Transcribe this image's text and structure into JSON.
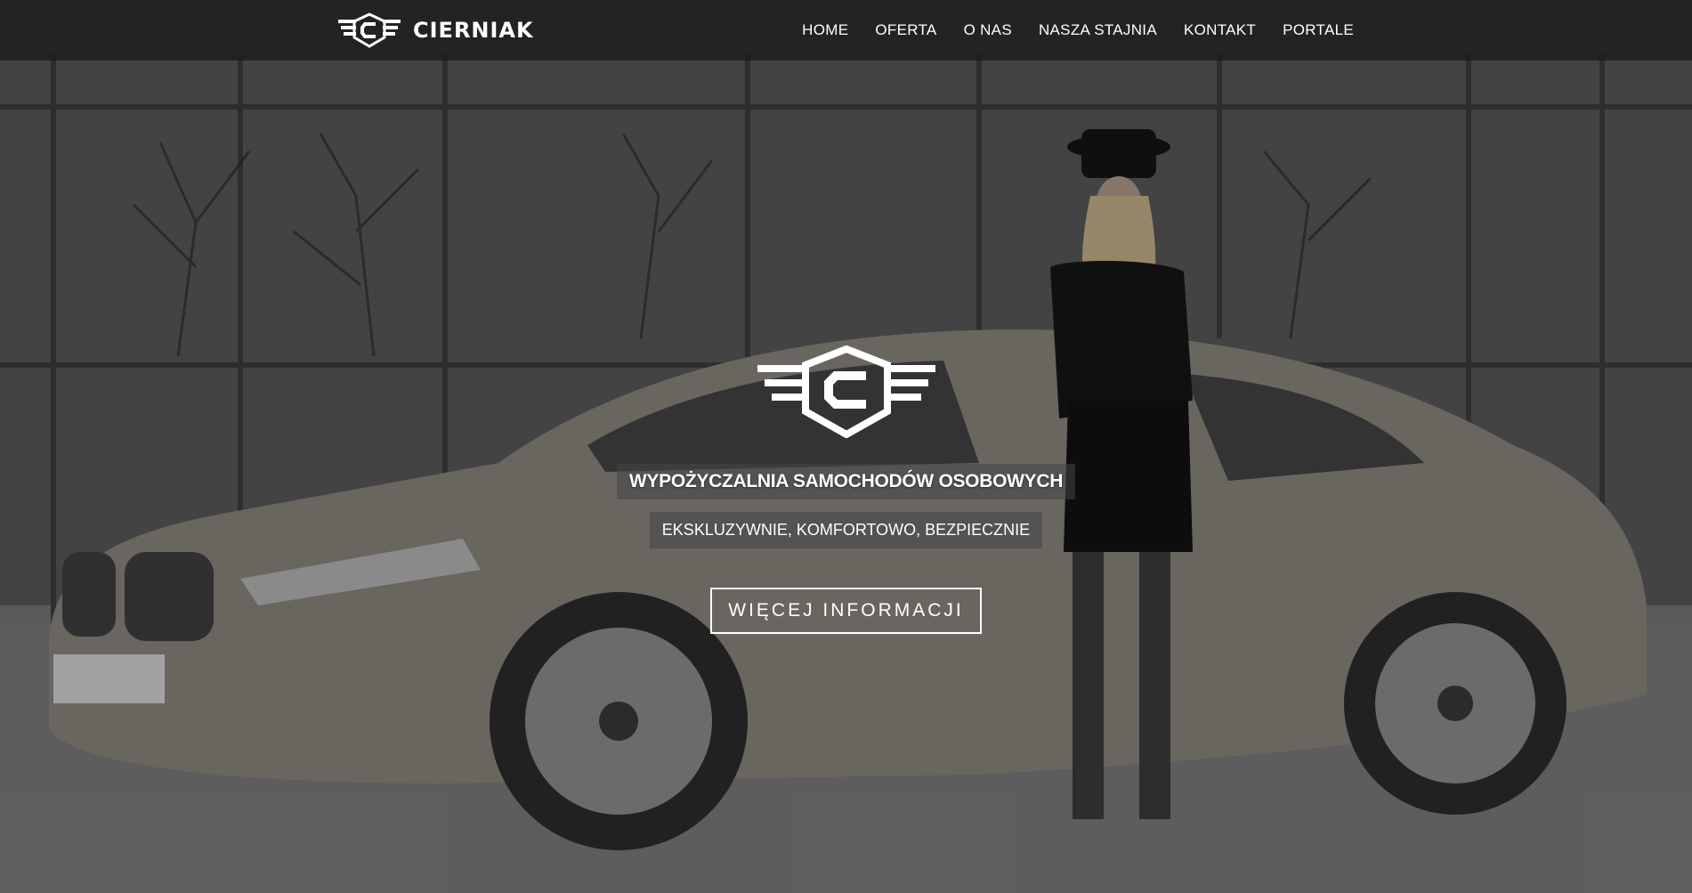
{
  "brand": {
    "name": "CIERNIAK",
    "logo_icon": "cierniak-winged-c-logo"
  },
  "nav": {
    "items": [
      {
        "label": "HOME"
      },
      {
        "label": "OFERTA"
      },
      {
        "label": "O NAS"
      },
      {
        "label": "NASZA STAJNIA"
      },
      {
        "label": "KONTAKT"
      },
      {
        "label": "PORTALE"
      }
    ]
  },
  "hero": {
    "headline": "WYPOŻYCZALNIA SAMOCHODÓW OSOBOWYCH",
    "subline": "EKSKLUZYWNIE, KOMFORTOWO, BEZPIECZNIE",
    "cta_label": "WIĘCEJ INFORMACJI",
    "background_image": "silver-sedan-with-woman-in-top-hat-photo"
  },
  "colors": {
    "topbar": "#1c1c1c",
    "text": "#ffffff"
  }
}
